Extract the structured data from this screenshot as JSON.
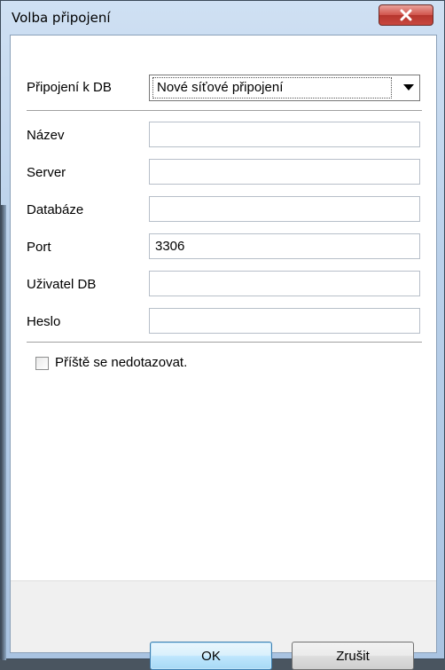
{
  "window": {
    "title": "Volba připojení"
  },
  "connection": {
    "label": "Připojení k DB",
    "selected": "Nové síťové připojení"
  },
  "fields": [
    {
      "label": "Název",
      "value": ""
    },
    {
      "label": "Server",
      "value": ""
    },
    {
      "label": "Databáze",
      "value": ""
    },
    {
      "label": "Port",
      "value": "3306"
    },
    {
      "label": "Uživatel DB",
      "value": ""
    },
    {
      "label": "Heslo",
      "value": ""
    }
  ],
  "checkbox": {
    "label": "Příště se nedotazovat.",
    "checked": false
  },
  "buttons": {
    "ok": "OK",
    "cancel": "Zrušit"
  }
}
